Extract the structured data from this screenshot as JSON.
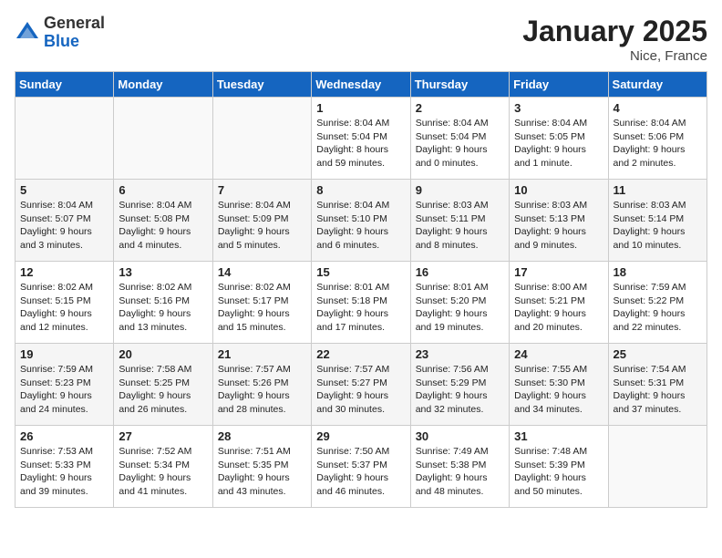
{
  "header": {
    "logo_general": "General",
    "logo_blue": "Blue",
    "month": "January 2025",
    "location": "Nice, France"
  },
  "weekdays": [
    "Sunday",
    "Monday",
    "Tuesday",
    "Wednesday",
    "Thursday",
    "Friday",
    "Saturday"
  ],
  "weeks": [
    [
      {
        "day": "",
        "info": ""
      },
      {
        "day": "",
        "info": ""
      },
      {
        "day": "",
        "info": ""
      },
      {
        "day": "1",
        "info": "Sunrise: 8:04 AM\nSunset: 5:04 PM\nDaylight: 8 hours\nand 59 minutes."
      },
      {
        "day": "2",
        "info": "Sunrise: 8:04 AM\nSunset: 5:04 PM\nDaylight: 9 hours\nand 0 minutes."
      },
      {
        "day": "3",
        "info": "Sunrise: 8:04 AM\nSunset: 5:05 PM\nDaylight: 9 hours\nand 1 minute."
      },
      {
        "day": "4",
        "info": "Sunrise: 8:04 AM\nSunset: 5:06 PM\nDaylight: 9 hours\nand 2 minutes."
      }
    ],
    [
      {
        "day": "5",
        "info": "Sunrise: 8:04 AM\nSunset: 5:07 PM\nDaylight: 9 hours\nand 3 minutes."
      },
      {
        "day": "6",
        "info": "Sunrise: 8:04 AM\nSunset: 5:08 PM\nDaylight: 9 hours\nand 4 minutes."
      },
      {
        "day": "7",
        "info": "Sunrise: 8:04 AM\nSunset: 5:09 PM\nDaylight: 9 hours\nand 5 minutes."
      },
      {
        "day": "8",
        "info": "Sunrise: 8:04 AM\nSunset: 5:10 PM\nDaylight: 9 hours\nand 6 minutes."
      },
      {
        "day": "9",
        "info": "Sunrise: 8:03 AM\nSunset: 5:11 PM\nDaylight: 9 hours\nand 8 minutes."
      },
      {
        "day": "10",
        "info": "Sunrise: 8:03 AM\nSunset: 5:13 PM\nDaylight: 9 hours\nand 9 minutes."
      },
      {
        "day": "11",
        "info": "Sunrise: 8:03 AM\nSunset: 5:14 PM\nDaylight: 9 hours\nand 10 minutes."
      }
    ],
    [
      {
        "day": "12",
        "info": "Sunrise: 8:02 AM\nSunset: 5:15 PM\nDaylight: 9 hours\nand 12 minutes."
      },
      {
        "day": "13",
        "info": "Sunrise: 8:02 AM\nSunset: 5:16 PM\nDaylight: 9 hours\nand 13 minutes."
      },
      {
        "day": "14",
        "info": "Sunrise: 8:02 AM\nSunset: 5:17 PM\nDaylight: 9 hours\nand 15 minutes."
      },
      {
        "day": "15",
        "info": "Sunrise: 8:01 AM\nSunset: 5:18 PM\nDaylight: 9 hours\nand 17 minutes."
      },
      {
        "day": "16",
        "info": "Sunrise: 8:01 AM\nSunset: 5:20 PM\nDaylight: 9 hours\nand 19 minutes."
      },
      {
        "day": "17",
        "info": "Sunrise: 8:00 AM\nSunset: 5:21 PM\nDaylight: 9 hours\nand 20 minutes."
      },
      {
        "day": "18",
        "info": "Sunrise: 7:59 AM\nSunset: 5:22 PM\nDaylight: 9 hours\nand 22 minutes."
      }
    ],
    [
      {
        "day": "19",
        "info": "Sunrise: 7:59 AM\nSunset: 5:23 PM\nDaylight: 9 hours\nand 24 minutes."
      },
      {
        "day": "20",
        "info": "Sunrise: 7:58 AM\nSunset: 5:25 PM\nDaylight: 9 hours\nand 26 minutes."
      },
      {
        "day": "21",
        "info": "Sunrise: 7:57 AM\nSunset: 5:26 PM\nDaylight: 9 hours\nand 28 minutes."
      },
      {
        "day": "22",
        "info": "Sunrise: 7:57 AM\nSunset: 5:27 PM\nDaylight: 9 hours\nand 30 minutes."
      },
      {
        "day": "23",
        "info": "Sunrise: 7:56 AM\nSunset: 5:29 PM\nDaylight: 9 hours\nand 32 minutes."
      },
      {
        "day": "24",
        "info": "Sunrise: 7:55 AM\nSunset: 5:30 PM\nDaylight: 9 hours\nand 34 minutes."
      },
      {
        "day": "25",
        "info": "Sunrise: 7:54 AM\nSunset: 5:31 PM\nDaylight: 9 hours\nand 37 minutes."
      }
    ],
    [
      {
        "day": "26",
        "info": "Sunrise: 7:53 AM\nSunset: 5:33 PM\nDaylight: 9 hours\nand 39 minutes."
      },
      {
        "day": "27",
        "info": "Sunrise: 7:52 AM\nSunset: 5:34 PM\nDaylight: 9 hours\nand 41 minutes."
      },
      {
        "day": "28",
        "info": "Sunrise: 7:51 AM\nSunset: 5:35 PM\nDaylight: 9 hours\nand 43 minutes."
      },
      {
        "day": "29",
        "info": "Sunrise: 7:50 AM\nSunset: 5:37 PM\nDaylight: 9 hours\nand 46 minutes."
      },
      {
        "day": "30",
        "info": "Sunrise: 7:49 AM\nSunset: 5:38 PM\nDaylight: 9 hours\nand 48 minutes."
      },
      {
        "day": "31",
        "info": "Sunrise: 7:48 AM\nSunset: 5:39 PM\nDaylight: 9 hours\nand 50 minutes."
      },
      {
        "day": "",
        "info": ""
      }
    ]
  ]
}
